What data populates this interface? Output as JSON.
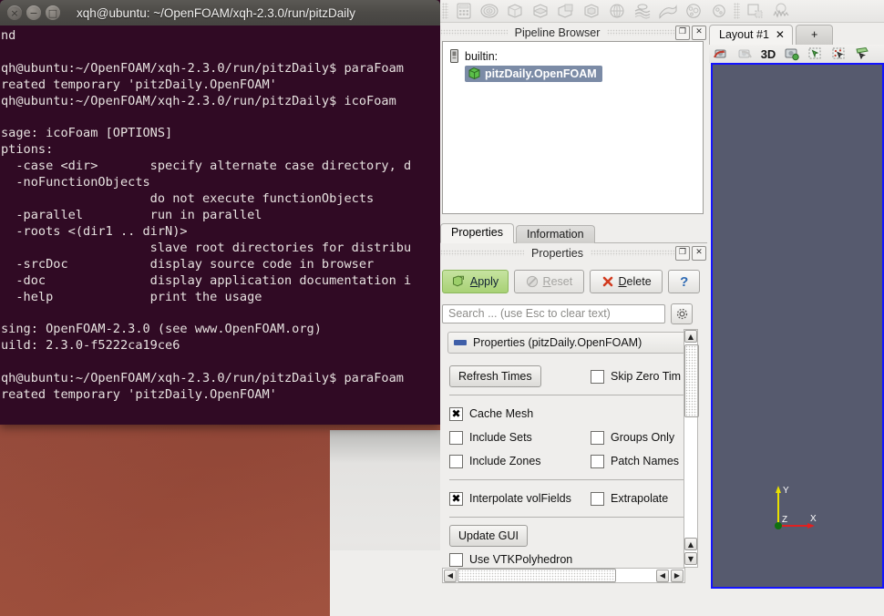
{
  "terminal": {
    "title": "xqh@ubuntu: ~/OpenFOAM/xqh-2.3.0/run/pitzDaily",
    "buttons": {
      "close": "×",
      "minimize": "−",
      "maximize": "□"
    },
    "lines": [
      "nd",
      "",
      "qh@ubuntu:~/OpenFOAM/xqh-2.3.0/run/pitzDaily$ paraFoam",
      "reated temporary 'pitzDaily.OpenFOAM'",
      "qh@ubuntu:~/OpenFOAM/xqh-2.3.0/run/pitzDaily$ icoFoam",
      "",
      "sage: icoFoam [OPTIONS]",
      "ptions:",
      "  -case <dir>       specify alternate case directory, d",
      "  -noFunctionObjects",
      "                    do not execute functionObjects",
      "  -parallel         run in parallel",
      "  -roots <(dir1 .. dirN)>",
      "                    slave root directories for distribu",
      "  -srcDoc           display source code in browser",
      "  -doc              display application documentation i",
      "  -help             print the usage",
      "",
      "sing: OpenFOAM-2.3.0 (see www.OpenFOAM.org)",
      "uild: 2.3.0-f5222ca19ce6",
      "",
      "qh@ubuntu:~/OpenFOAM/xqh-2.3.0/run/pitzDaily$ paraFoam",
      "reated temporary 'pitzDaily.OpenFOAM'"
    ]
  },
  "filter_toolbar": {
    "icons": [
      "calculator-icon",
      "contour-icon",
      "clip-icon",
      "slice-icon",
      "threshold-icon",
      "extract-subset-icon",
      "glyph-icon",
      "stream-tracer-icon",
      "warp-icon",
      "group-datasets-icon",
      "extract-level-icon",
      "rectilinear-icon",
      "plot-over-line-icon"
    ]
  },
  "pipeline": {
    "title": "Pipeline Browser",
    "dock_buttons": {
      "float": "❐",
      "close": "✕"
    },
    "items": [
      {
        "label": "builtin:",
        "icon": "server-icon",
        "selected": false
      },
      {
        "label": "pitzDaily.OpenFOAM",
        "icon": "source-icon",
        "selected": true
      }
    ]
  },
  "properties_panel": {
    "tabs": [
      {
        "label": "Properties",
        "active": true
      },
      {
        "label": "Information",
        "active": false
      }
    ],
    "dock_title": "Properties",
    "dock_buttons": {
      "float": "❐",
      "close": "✕"
    },
    "buttons": {
      "apply": "Apply",
      "apply_mnemonic": "A",
      "reset": "Reset",
      "reset_mnemonic": "R",
      "delete": "Delete",
      "delete_mnemonic": "D",
      "help": "?"
    },
    "search": {
      "placeholder": "Search ... (use Esc to clear text)",
      "value": ""
    },
    "gear_icon": "gear-icon",
    "group_header": "Properties (pitzDaily.OpenFOAM)",
    "controls": {
      "refresh_times": "Refresh Times",
      "skip_zero_time": "Skip Zero Tim",
      "skip_zero_time_checked": false,
      "cache_mesh": "Cache Mesh",
      "cache_mesh_checked": true,
      "include_sets": "Include Sets",
      "include_sets_checked": false,
      "groups_only": "Groups Only",
      "groups_only_checked": false,
      "include_zones": "Include Zones",
      "include_zones_checked": false,
      "patch_names": "Patch Names",
      "patch_names_checked": false,
      "interpolate_volfields": "Interpolate volFields",
      "interpolate_volfields_checked": true,
      "extrapolate": "Extrapolate ",
      "extrapolate_checked": false,
      "update_gui": "Update GUI",
      "use_vtk_polyhedron": "Use VTKPolyhedron",
      "use_vtk_polyhedron_checked": false
    },
    "scroll_arrows": {
      "up": "▲",
      "down": "▼",
      "left": "◀",
      "right": "▶"
    }
  },
  "layout": {
    "tabs": [
      {
        "label": "Layout #1",
        "close": "✕",
        "active": true
      },
      {
        "label": "+",
        "active": false
      }
    ],
    "view_toolbar": {
      "label_3d": "3D",
      "icons": [
        "undo-camera-icon",
        "redo-camera-icon",
        "camera-icon",
        "select-surface-cells-icon",
        "select-surface-points-icon",
        "select-frustum-icon"
      ]
    }
  },
  "render_view": {
    "background_color": "#565a6e",
    "border_color": "#1414ff",
    "axes": [
      {
        "label": "X",
        "color": "#e02020"
      },
      {
        "label": "Y",
        "color": "#e8e000"
      },
      {
        "label": "Z",
        "color": "#ffffff"
      }
    ],
    "origin_color": "#107010"
  }
}
